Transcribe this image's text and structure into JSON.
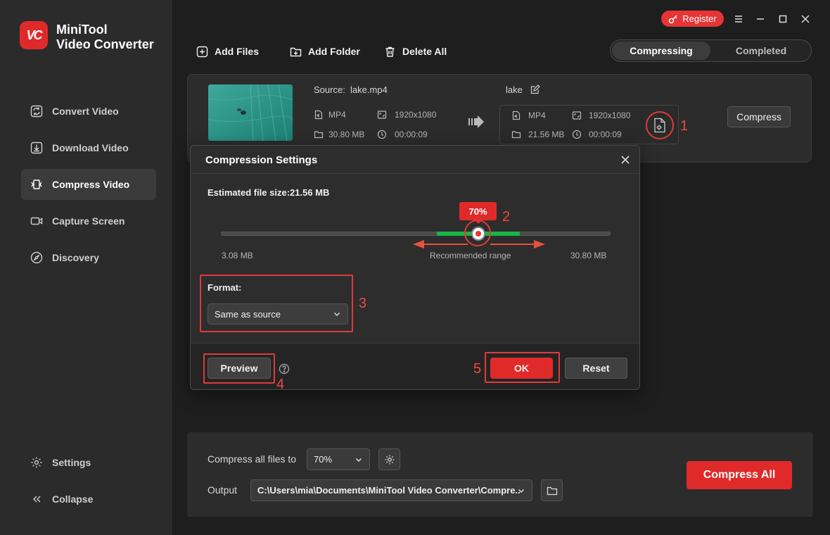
{
  "app": {
    "logo_text": "VC",
    "title_line1": "MiniTool",
    "title_line2": "Video Converter"
  },
  "header": {
    "register_label": "Register"
  },
  "sidebar": {
    "items": [
      {
        "label": "Convert Video",
        "icon": "convert-icon",
        "active": false
      },
      {
        "label": "Download Video",
        "icon": "download-icon",
        "active": false
      },
      {
        "label": "Compress Video",
        "icon": "compress-icon",
        "active": true
      },
      {
        "label": "Capture Screen",
        "icon": "camera-icon",
        "active": false
      },
      {
        "label": "Discovery",
        "icon": "compass-icon",
        "active": false
      }
    ],
    "settings_label": "Settings",
    "collapse_label": "Collapse"
  },
  "toolbar": {
    "add_files": "Add Files",
    "add_folder": "Add Folder",
    "delete_all": "Delete All"
  },
  "tabs": {
    "compressing": "Compressing",
    "completed": "Completed",
    "active": "compressing"
  },
  "file": {
    "source_label": "Source:",
    "source_name": "lake.mp4",
    "src_format": "MP4",
    "src_resolution": "1920x1080",
    "src_size": "30.80 MB",
    "src_duration": "00:00:09",
    "target_name": "lake",
    "tgt_format": "MP4",
    "tgt_resolution": "1920x1080",
    "tgt_size": "21.56 MB",
    "tgt_duration": "00:00:09",
    "compress_label": "Compress"
  },
  "dialog": {
    "title": "Compression Settings",
    "estimated": "Estimated file size:21.56 MB",
    "percent": "70%",
    "percent_value": 70,
    "min_label": "3.08 MB",
    "max_label": "30.80 MB",
    "recommended": "Recommended range",
    "format_label": "Format:",
    "format_value": "Same as source",
    "preview_label": "Preview",
    "ok_label": "OK",
    "reset_label": "Reset"
  },
  "annotations": [
    "1",
    "2",
    "3",
    "4",
    "5"
  ],
  "bottom": {
    "compress_all_files_label": "Compress all files to",
    "compress_percent": "70%",
    "output_label": "Output",
    "output_path": "C:\\Users\\mia\\Documents\\MiniTool Video Converter\\Compre..",
    "compress_all_label": "Compress All"
  },
  "colors": {
    "accent": "#e02a2a",
    "recommended": "#19b447",
    "annotation": "#e03a3a"
  }
}
